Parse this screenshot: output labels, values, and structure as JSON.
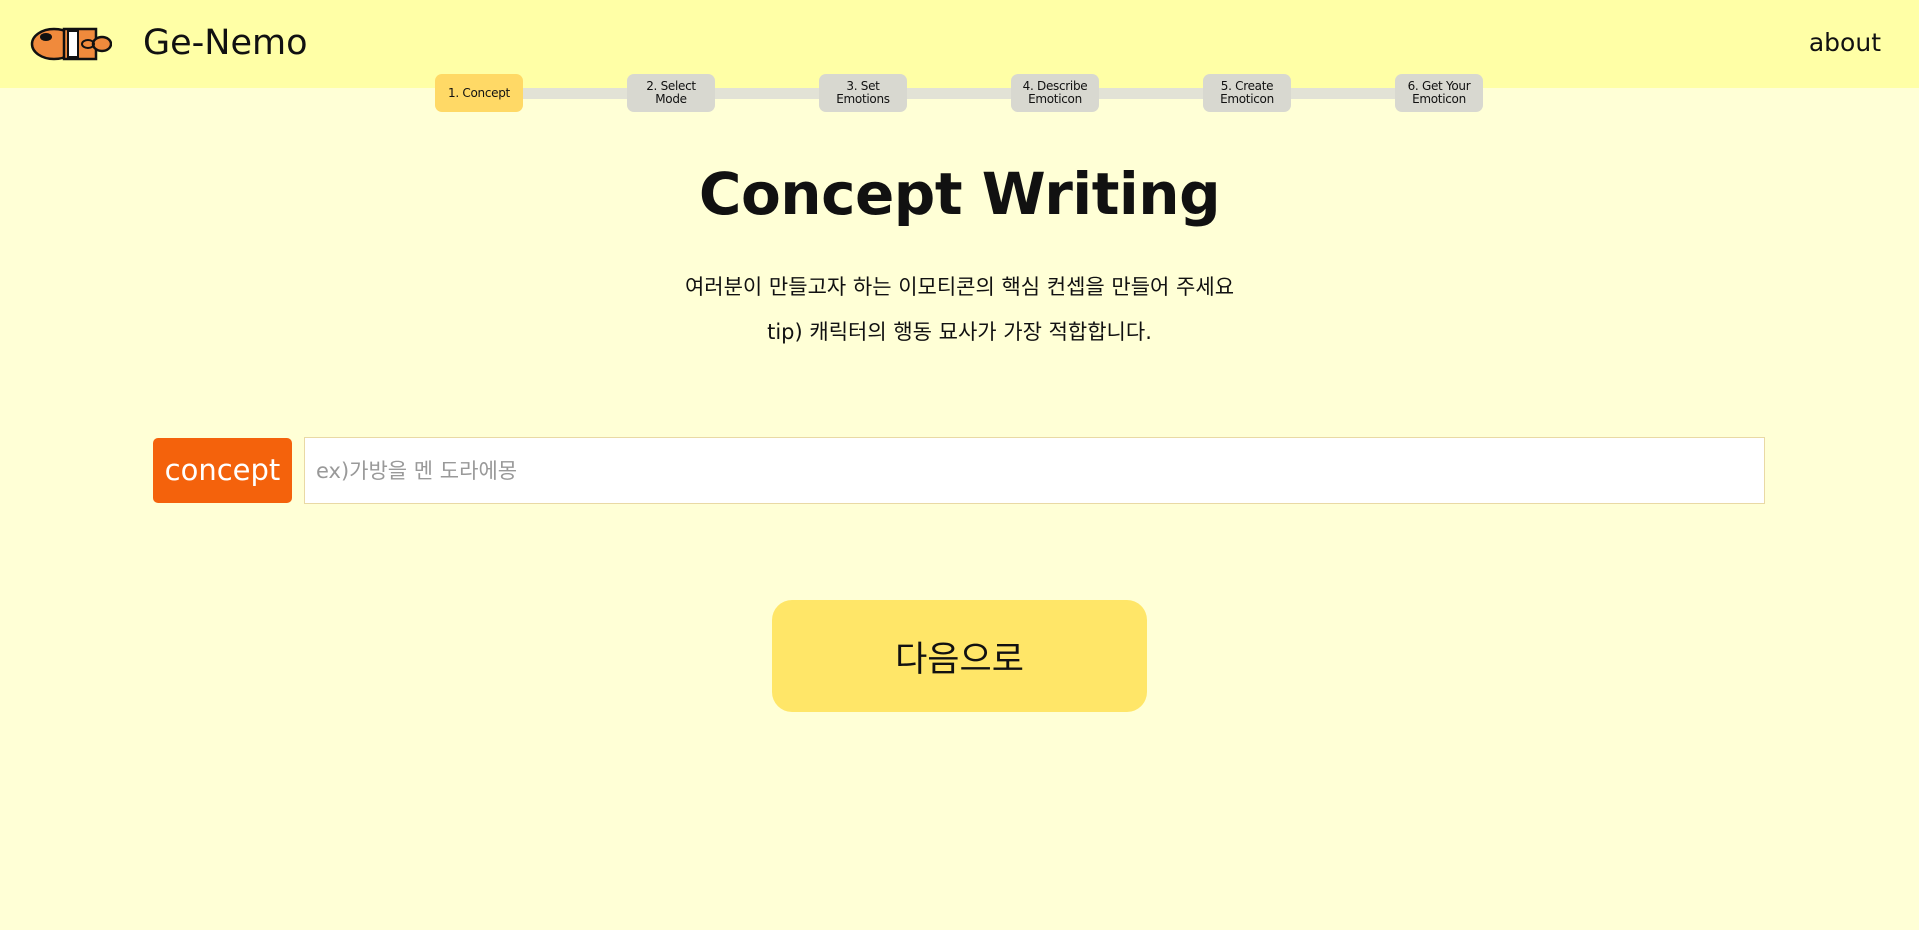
{
  "header": {
    "brand": "Ge-Nemo",
    "about_label": "about",
    "logo_icon": "fish-logo-icon"
  },
  "steps": [
    {
      "label": "1. Concept",
      "active": true
    },
    {
      "label": "2. Select Mode",
      "active": false
    },
    {
      "label": "3. Set\nEmotions",
      "active": false
    },
    {
      "label": "4. Describe\nEmoticon",
      "active": false
    },
    {
      "label": "5. Create\nEmoticon",
      "active": false
    },
    {
      "label": "6. Get Your\nEmoticon",
      "active": false
    }
  ],
  "main": {
    "title": "Concept Writing",
    "description_line1": "여러분이 만들고자 하는 이모티콘의 핵심 컨셉을 만들어 주세요",
    "description_line2": "tip) 캐릭터의 행동 묘사가 가장 적합합니다.",
    "concept_label": "concept",
    "concept_input": {
      "value": "",
      "placeholder": "ex)가방을 멘 도라에몽"
    },
    "next_button_label": "다음으로"
  },
  "colors": {
    "background": "#FFFFD6",
    "header_background": "#FFFFA6",
    "step_active": "#FFD966",
    "step_inactive": "#D8D8D0",
    "concept_label": "#F4620C",
    "next_button": "#FFE668",
    "logo_orange": "#F08A3C"
  }
}
